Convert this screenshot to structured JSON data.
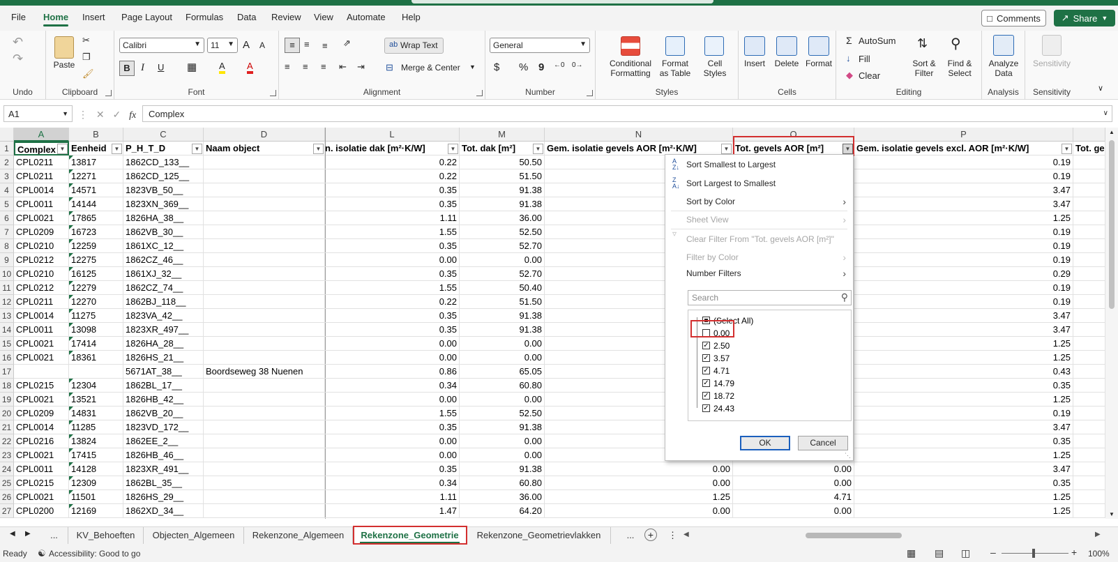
{
  "menu": {
    "tabs": [
      "File",
      "Home",
      "Insert",
      "Page Layout",
      "Formulas",
      "Data",
      "Review",
      "View",
      "Automate",
      "Help"
    ],
    "active": "Home",
    "comments_label": "Comments",
    "share_label": "Share"
  },
  "ribbon": {
    "undo_label": "Undo",
    "clipboard": {
      "label": "Clipboard",
      "paste": "Paste"
    },
    "font": {
      "label": "Font",
      "name": "Calibri",
      "size": "11",
      "bold": "B",
      "italic": "I",
      "underline": "U",
      "grow": "A",
      "shrink": "A",
      "fill_glyph": "A",
      "color_glyph": "A"
    },
    "alignment": {
      "label": "Alignment",
      "wrap_text": "Wrap Text",
      "merge_center": "Merge & Center"
    },
    "number": {
      "label": "Number",
      "format": "General",
      "currency": "$",
      "percent": "%",
      "comma": "9"
    },
    "styles": {
      "label": "Styles",
      "conditional": "Conditional Formatting",
      "format_table": "Format as Table",
      "cell_styles": "Cell Styles"
    },
    "cells": {
      "label": "Cells",
      "insert": "Insert",
      "delete": "Delete",
      "format": "Format"
    },
    "editing": {
      "label": "Editing",
      "autosum": "AutoSum",
      "fill": "Fill",
      "clear": "Clear",
      "sort_filter": "Sort & Filter",
      "find_select": "Find & Select"
    },
    "analysis": {
      "label": "Analysis",
      "analyze": "Analyze Data"
    },
    "sensitivity": {
      "label": "Sensitivity",
      "button": "Sensitivity"
    }
  },
  "formula_bar": {
    "name_box": "A1",
    "fx": "fx",
    "value": "Complex"
  },
  "grid": {
    "columns": [
      "A",
      "B",
      "C",
      "D",
      "L",
      "M",
      "N",
      "O",
      "P"
    ],
    "selected_column": "A",
    "header_row": [
      "Complex",
      "Eenheid",
      "P_H_T_D",
      "Naam object",
      "n. isolatie dak [m²·K/W]",
      "Tot. dak [m²]",
      "Gem. isolatie gevels AOR [m²·K/W]",
      "Tot. gevels AOR [m²]",
      "Gem. isolatie gevels excl. AOR [m²·K/W]",
      "Tot. ge"
    ],
    "rows": [
      {
        "n": "2",
        "a": "CPL0211",
        "b": "13817",
        "c": "1862CD_133__",
        "d": "",
        "l": "0.22",
        "m": "50.50",
        "n_val": "",
        "o": "",
        "p": "0.19"
      },
      {
        "n": "3",
        "a": "CPL0211",
        "b": "12271",
        "c": "1862CD_125__",
        "d": "",
        "l": "0.22",
        "m": "51.50",
        "n_val": "",
        "o": "",
        "p": "0.19"
      },
      {
        "n": "4",
        "a": "CPL0014",
        "b": "14571",
        "c": "1823VB_50__",
        "d": "",
        "l": "0.35",
        "m": "91.38",
        "n_val": "",
        "o": "",
        "p": "3.47"
      },
      {
        "n": "5",
        "a": "CPL0011",
        "b": "14144",
        "c": "1823XN_369__",
        "d": "",
        "l": "0.35",
        "m": "91.38",
        "n_val": "",
        "o": "",
        "p": "3.47"
      },
      {
        "n": "6",
        "a": "CPL0021",
        "b": "17865",
        "c": "1826HA_38__",
        "d": "",
        "l": "1.11",
        "m": "36.00",
        "n_val": "",
        "o": "",
        "p": "1.25"
      },
      {
        "n": "7",
        "a": "CPL0209",
        "b": "16723",
        "c": "1862VB_30__",
        "d": "",
        "l": "1.55",
        "m": "52.50",
        "n_val": "",
        "o": "",
        "p": "0.19"
      },
      {
        "n": "8",
        "a": "CPL0210",
        "b": "12259",
        "c": "1861XC_12__",
        "d": "",
        "l": "0.35",
        "m": "52.70",
        "n_val": "",
        "o": "",
        "p": "0.19"
      },
      {
        "n": "9",
        "a": "CPL0212",
        "b": "12275",
        "c": "1862CZ_46__",
        "d": "",
        "l": "0.00",
        "m": "0.00",
        "n_val": "",
        "o": "",
        "p": "0.19"
      },
      {
        "n": "10",
        "a": "CPL0210",
        "b": "16125",
        "c": "1861XJ_32__",
        "d": "",
        "l": "0.35",
        "m": "52.70",
        "n_val": "",
        "o": "",
        "p": "0.29"
      },
      {
        "n": "11",
        "a": "CPL0212",
        "b": "12279",
        "c": "1862CZ_74__",
        "d": "",
        "l": "1.55",
        "m": "50.40",
        "n_val": "",
        "o": "",
        "p": "0.19"
      },
      {
        "n": "12",
        "a": "CPL0211",
        "b": "12270",
        "c": "1862BJ_118__",
        "d": "",
        "l": "0.22",
        "m": "51.50",
        "n_val": "",
        "o": "",
        "p": "0.19"
      },
      {
        "n": "13",
        "a": "CPL0014",
        "b": "11275",
        "c": "1823VA_42__",
        "d": "",
        "l": "0.35",
        "m": "91.38",
        "n_val": "",
        "o": "",
        "p": "3.47"
      },
      {
        "n": "14",
        "a": "CPL0011",
        "b": "13098",
        "c": "1823XR_497__",
        "d": "",
        "l": "0.35",
        "m": "91.38",
        "n_val": "",
        "o": "",
        "p": "3.47"
      },
      {
        "n": "15",
        "a": "CPL0021",
        "b": "17414",
        "c": "1826HA_28__",
        "d": "",
        "l": "0.00",
        "m": "0.00",
        "n_val": "",
        "o": "",
        "p": "1.25"
      },
      {
        "n": "16",
        "a": "CPL0021",
        "b": "18361",
        "c": "1826HS_21__",
        "d": "",
        "l": "0.00",
        "m": "0.00",
        "n_val": "",
        "o": "",
        "p": "1.25"
      },
      {
        "n": "17",
        "a": "",
        "b": "",
        "c": "5671AT_38__",
        "d": "Boordseweg 38 Nuenen",
        "l": "0.86",
        "m": "65.05",
        "n_val": "",
        "o": "",
        "p": "0.43"
      },
      {
        "n": "18",
        "a": "CPL0215",
        "b": "12304",
        "c": "1862BL_17__",
        "d": "",
        "l": "0.34",
        "m": "60.80",
        "n_val": "",
        "o": "",
        "p": "0.35"
      },
      {
        "n": "19",
        "a": "CPL0021",
        "b": "13521",
        "c": "1826HB_42__",
        "d": "",
        "l": "0.00",
        "m": "0.00",
        "n_val": "",
        "o": "",
        "p": "1.25"
      },
      {
        "n": "20",
        "a": "CPL0209",
        "b": "14831",
        "c": "1862VB_20__",
        "d": "",
        "l": "1.55",
        "m": "52.50",
        "n_val": "",
        "o": "",
        "p": "0.19"
      },
      {
        "n": "21",
        "a": "CPL0014",
        "b": "11285",
        "c": "1823VD_172__",
        "d": "",
        "l": "0.35",
        "m": "91.38",
        "n_val": "",
        "o": "",
        "p": "3.47"
      },
      {
        "n": "22",
        "a": "CPL0216",
        "b": "13824",
        "c": "1862EE_2__",
        "d": "",
        "l": "0.00",
        "m": "0.00",
        "n_val": "",
        "o": "",
        "p": "0.35"
      },
      {
        "n": "23",
        "a": "CPL0021",
        "b": "17415",
        "c": "1826HB_46__",
        "d": "",
        "l": "0.00",
        "m": "0.00",
        "n_val": "",
        "o": "",
        "p": "1.25"
      },
      {
        "n": "24",
        "a": "CPL0011",
        "b": "14128",
        "c": "1823XR_491__",
        "d": "",
        "l": "0.35",
        "m": "91.38",
        "n_val": "0.00",
        "o": "0.00",
        "p": "3.47"
      },
      {
        "n": "25",
        "a": "CPL0215",
        "b": "12309",
        "c": "1862BL_35__",
        "d": "",
        "l": "0.34",
        "m": "60.80",
        "n_val": "0.00",
        "o": "0.00",
        "p": "0.35"
      },
      {
        "n": "26",
        "a": "CPL0021",
        "b": "11501",
        "c": "1826HS_29__",
        "d": "",
        "l": "1.11",
        "m": "36.00",
        "n_val": "1.25",
        "o": "4.71",
        "p": "1.25"
      },
      {
        "n": "27",
        "a": "CPL0200",
        "b": "12169",
        "c": "1862XD_34__",
        "d": "",
        "l": "1.47",
        "m": "64.20",
        "n_val": "0.00",
        "o": "0.00",
        "p": "1.25"
      }
    ]
  },
  "filter_menu": {
    "sort_asc": "Sort Smallest to Largest",
    "sort_desc": "Sort Largest to Smallest",
    "sort_color": "Sort by Color",
    "sheet_view": "Sheet View",
    "clear_filter": "Clear Filter From \"Tot. gevels AOR [m²]\"",
    "filter_color": "Filter by Color",
    "number_filters": "Number Filters",
    "search_placeholder": "Search",
    "items": [
      {
        "label": "(Select All)",
        "state": "partial"
      },
      {
        "label": "0.00",
        "state": "unchecked"
      },
      {
        "label": "2.50",
        "state": "checked"
      },
      {
        "label": "3.57",
        "state": "checked"
      },
      {
        "label": "4.71",
        "state": "checked"
      },
      {
        "label": "14.79",
        "state": "checked"
      },
      {
        "label": "18.72",
        "state": "checked"
      },
      {
        "label": "24.43",
        "state": "checked"
      }
    ],
    "ok": "OK",
    "cancel": "Cancel"
  },
  "sheet_tabs": {
    "more_left": "...",
    "tabs": [
      "KV_Behoeften",
      "Objecten_Algemeen",
      "Rekenzone_Algemeen",
      "Rekenzone_Geometrie",
      "Rekenzone_Geometrievlakken"
    ],
    "active": "Rekenzone_Geometrie",
    "more_right": "..."
  },
  "status": {
    "ready": "Ready",
    "accessibility": "Accessibility: Good to go",
    "zoom": "100%"
  },
  "colors": {
    "accent": "#1e7145",
    "highlight": "#d32f2f"
  }
}
